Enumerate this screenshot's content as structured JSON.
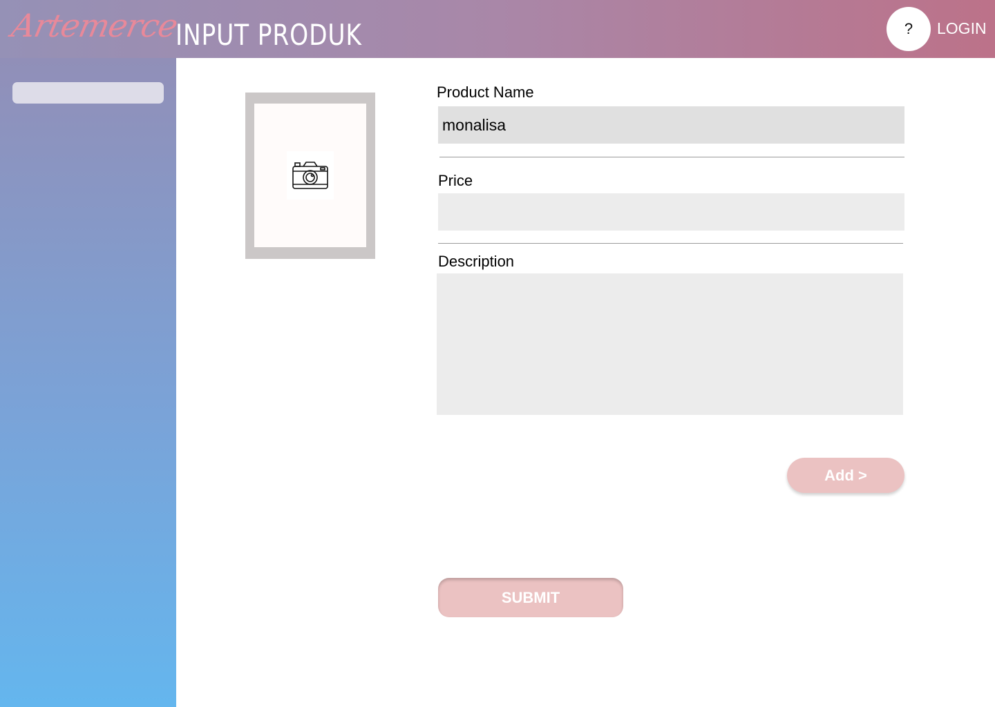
{
  "header": {
    "logo": "Artemerce",
    "title": "INPUT PRODUK",
    "help_label": "?",
    "login_label": "LOGIN"
  },
  "sidebar": {
    "search_value": ""
  },
  "image_upload": {
    "icon": "camera-icon"
  },
  "form": {
    "product_name_label": "Product Name",
    "product_name_value": "monalisa",
    "price_label": "Price",
    "price_value": "",
    "description_label": "Description",
    "description_value": "",
    "add_label": "Add >",
    "submit_label": "SUBMIT"
  },
  "colors": {
    "header_start": "#9591b6",
    "header_end": "#bc7289",
    "sidebar_top": "#918fb8",
    "sidebar_bottom": "#64b6ee",
    "logo": "#e8899a",
    "button": "#ebc2c2",
    "input_filled": "#e0e0e0",
    "input_empty": "#ececec"
  }
}
